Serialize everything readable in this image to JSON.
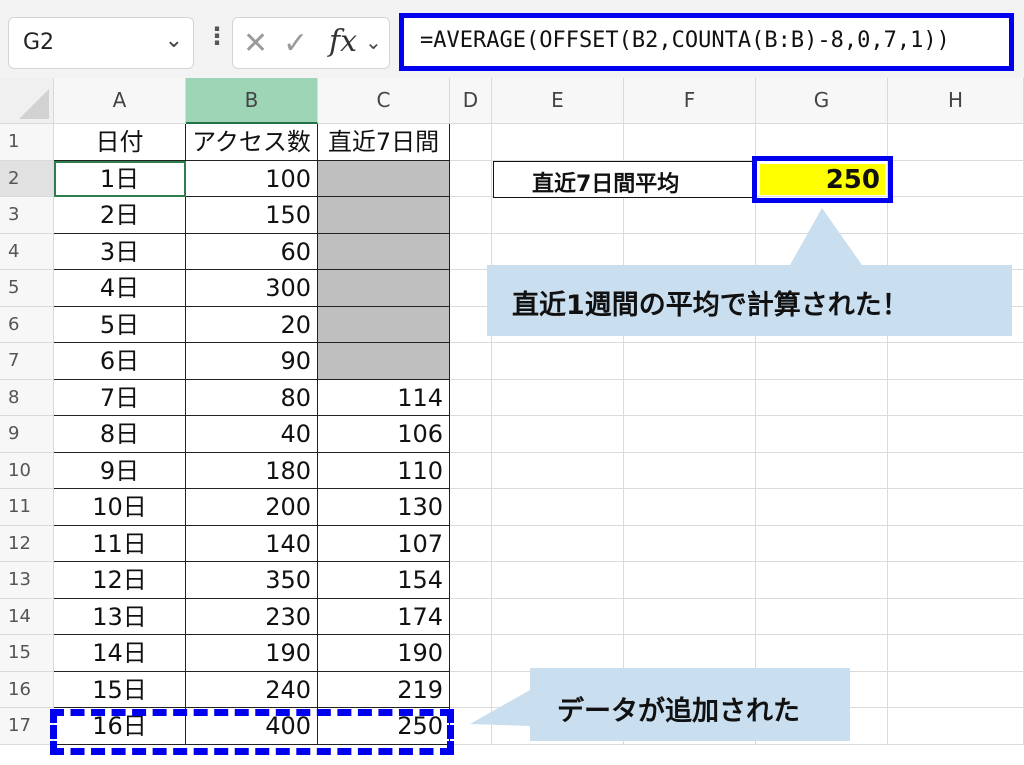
{
  "formula_bar": {
    "name_box": "G2",
    "formula": "=AVERAGE(OFFSET(B2,COUNTA(B:B)-8,0,7,1))"
  },
  "columns": [
    "A",
    "B",
    "C",
    "D",
    "E",
    "F",
    "G",
    "H"
  ],
  "rows": [
    {
      "num": "1",
      "a": "日付",
      "b": "アクセス数",
      "c": "直近7日間"
    },
    {
      "num": "2",
      "a": "1日",
      "b": "100",
      "c": ""
    },
    {
      "num": "3",
      "a": "2日",
      "b": "150",
      "c": ""
    },
    {
      "num": "4",
      "a": "3日",
      "b": "60",
      "c": ""
    },
    {
      "num": "5",
      "a": "4日",
      "b": "300",
      "c": ""
    },
    {
      "num": "6",
      "a": "5日",
      "b": "20",
      "c": ""
    },
    {
      "num": "7",
      "a": "6日",
      "b": "90",
      "c": ""
    },
    {
      "num": "8",
      "a": "7日",
      "b": "80",
      "c": "114"
    },
    {
      "num": "9",
      "a": "8日",
      "b": "40",
      "c": "106"
    },
    {
      "num": "10",
      "a": "9日",
      "b": "180",
      "c": "110"
    },
    {
      "num": "11",
      "a": "10日",
      "b": "200",
      "c": "130"
    },
    {
      "num": "12",
      "a": "11日",
      "b": "140",
      "c": "107"
    },
    {
      "num": "13",
      "a": "12日",
      "b": "350",
      "c": "154"
    },
    {
      "num": "14",
      "a": "13日",
      "b": "230",
      "c": "174"
    },
    {
      "num": "15",
      "a": "14日",
      "b": "190",
      "c": "190"
    },
    {
      "num": "16",
      "a": "15日",
      "b": "240",
      "c": "219"
    },
    {
      "num": "17",
      "a": "16日",
      "b": "400",
      "c": "250"
    }
  ],
  "summary": {
    "label": "直近7日間平均",
    "value": "250"
  },
  "callouts": {
    "top": "直近1週間の平均で計算された！",
    "bottom": "データが追加された"
  },
  "colors": {
    "highlight": "#ffff00",
    "emphasis": "#0000ee",
    "callout": "#c9deef",
    "grey_cell": "#bfbfbf"
  },
  "icons": [
    "chevron-down-icon",
    "more-options-icon",
    "cancel-icon",
    "enter-icon",
    "function-icon"
  ]
}
